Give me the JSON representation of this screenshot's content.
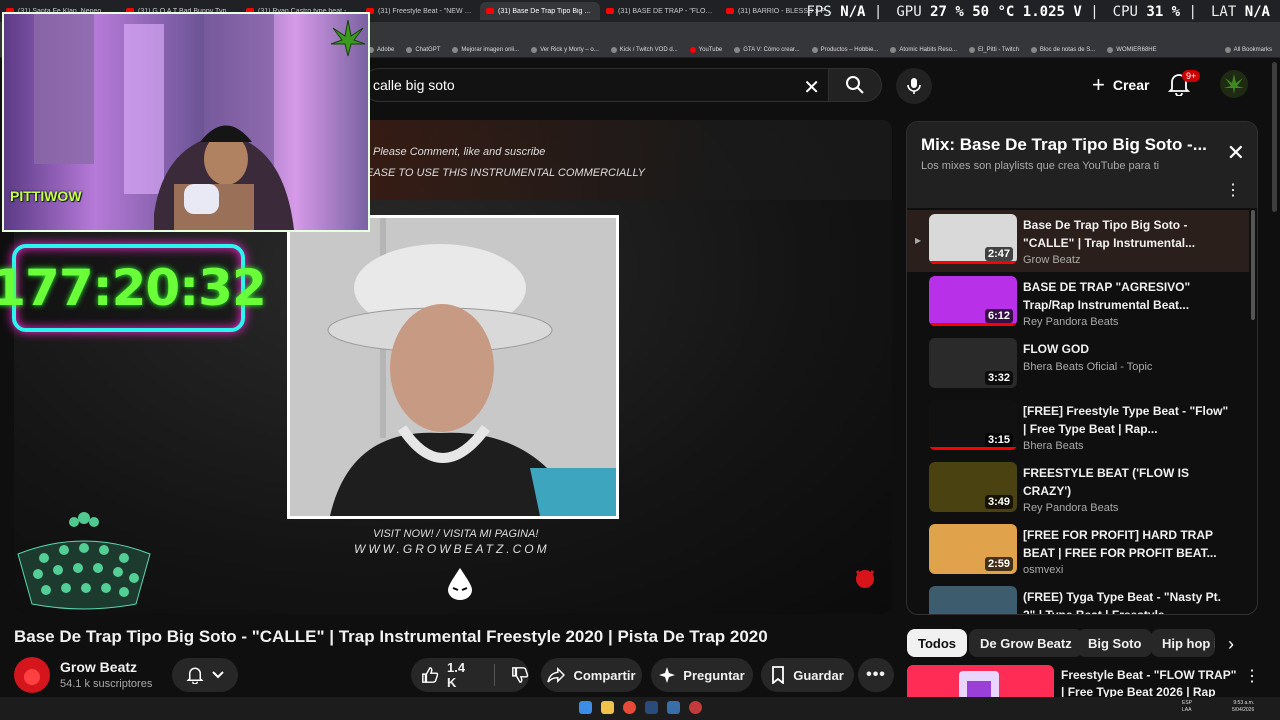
{
  "browser": {
    "tabs": [
      {
        "label": "(31) Santa Fe Klan, Neneo Rex..."
      },
      {
        "label": "(31) G O A T Bad Bunny Type B..."
      },
      {
        "label": "(31) Ryan Castro type beat - B..."
      },
      {
        "label": "(31) Freestyle Beat - \"NEW WA..."
      },
      {
        "label": "(31) Base De Trap Tipo Big ..."
      },
      {
        "label": "(31) BASE DE TRAP - \"FLOW G..."
      },
      {
        "label": "(31) BARRIO - BLESSD x PIRLO..."
      }
    ],
    "bookmarks": [
      "Adobe",
      "ChatGPT",
      "Mejorar imagen onli...",
      "Ver Rick y Morty – o...",
      "Kick / Twitch VOD d...",
      "YouTube",
      "GTA V: Cómo crear...",
      "Productos – Hobbie...",
      "Atomic Habits Reso...",
      "El_Pitti - Twitch",
      "Bloc de notas de S...",
      "WOMIER68HE",
      "All Bookmarks"
    ]
  },
  "stats_overlay": {
    "fps_label": "FPS",
    "fps_value": "N/A",
    "gpu_label": "GPU",
    "gpu_value": "27 % 50 °C 1.025 V",
    "cpu_label": "CPU",
    "cpu_value": "31 %",
    "lat_label": "LAT",
    "lat_value": "N/A"
  },
  "stream_overlay": {
    "webcam_logo": "PITTIWOW",
    "timer": "177:20:32"
  },
  "header": {
    "search_value": "calle big soto",
    "create_label": "Crear",
    "notifications_badge": "9+"
  },
  "player": {
    "line1": "Please Comment, like and suscribe",
    "line2": "EASE  TO USE THIS INSTRUMENTAL COMMERCIALLY",
    "visit": "VISIT NOW! / VISITA MI PAGINA!",
    "website": "WWW.GROWBEATZ.COM"
  },
  "video": {
    "title": "Base De Trap Tipo Big Soto - \"CALLE\" | Trap Instrumental Freestyle 2020 | Pista De Trap 2020",
    "channel": "Grow Beatz",
    "subscribers": "54.1 k suscriptores",
    "likes": "1.4 K",
    "share_label": "Compartir",
    "ask_label": "Preguntar",
    "save_label": "Guardar"
  },
  "mix": {
    "title": "Mix: Base De Trap Tipo Big Soto -...",
    "subtitle": "Los mixes son playlists que crea YouTube para ti",
    "items": [
      {
        "title": "Base De Trap Tipo Big Soto - \"CALLE\" | Trap Instrumental...",
        "channel": "Grow Beatz",
        "duration": "2:47",
        "thumb_color": "#d9d9d9"
      },
      {
        "title": "BASE DE TRAP \"AGRESIVO\" Trap/Rap Instrumental Beat...",
        "channel": "Rey Pandora Beats",
        "duration": "6:12",
        "thumb_color": "#b830e8"
      },
      {
        "title": "FLOW GOD",
        "channel": "Bhera Beats Oficial - Topic",
        "duration": "3:32",
        "thumb_color": "#2a2a2a"
      },
      {
        "title": "[FREE] Freestyle Type Beat - \"Flow\" | Free Type Beat | Rap...",
        "channel": "Bhera Beats",
        "duration": "3:15",
        "thumb_color": "#111111"
      },
      {
        "title": "FREESTYLE BEAT ('FLOW IS CRAZY')",
        "channel": "Rey Pandora Beats",
        "duration": "3:49",
        "thumb_color": "#4a4210"
      },
      {
        "title": "[FREE FOR PROFIT] HARD TRAP BEAT | FREE FOR PROFIT BEAT...",
        "channel": "osmvexi",
        "duration": "2:59",
        "thumb_color": "#e0a24a"
      },
      {
        "title": "(FREE) Tyga Type Beat - \"Nasty Pt. 2\" | Type Beat | Freestyle...",
        "channel": "",
        "duration": "3:38",
        "thumb_color": "#3d5c6e"
      }
    ]
  },
  "chips": [
    "Todos",
    "De Grow Beatz",
    "Big Soto",
    "Hip hop i"
  ],
  "next_video": {
    "title": "Freestyle Beat - \"FLOW TRAP\" | Free Type Beat 2026 | Rap Tra..."
  },
  "taskbar": {
    "lang": "ESP\nLAA",
    "time": "9:53 a.m.",
    "date": "5/04/2026"
  },
  "colors": {
    "yt_red": "#ff0000",
    "timer_green": "#6bff3a",
    "timer_border": "#2cf5f0",
    "timer_glow": "#ff2bd8"
  }
}
